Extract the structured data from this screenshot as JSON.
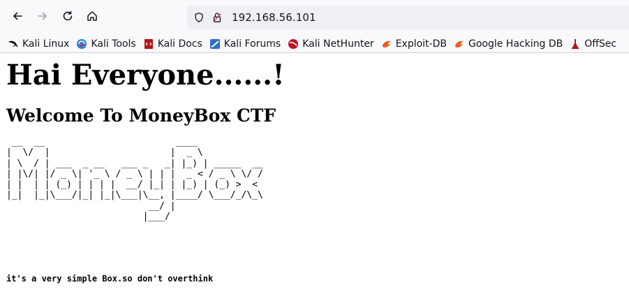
{
  "browser": {
    "url": "192.168.56.101",
    "icons": {
      "back": "arrow-left-icon",
      "forward": "arrow-right-icon",
      "reload": "reload-icon",
      "home": "home-icon",
      "shield": "shield-icon",
      "lock": "lock-icon"
    }
  },
  "bookmarks": [
    {
      "label": "Kali Linux",
      "icon": "kali-dragon-icon",
      "color": "#000000"
    },
    {
      "label": "Kali Tools",
      "icon": "kali-tools-icon",
      "color": "#2f7fd6"
    },
    {
      "label": "Kali Docs",
      "icon": "kali-docs-icon",
      "color": "#b5121b"
    },
    {
      "label": "Kali Forums",
      "icon": "kali-forums-icon",
      "color": "#2a6fc9"
    },
    {
      "label": "Kali NetHunter",
      "icon": "nethunter-icon",
      "color": "#c0111f"
    },
    {
      "label": "Exploit-DB",
      "icon": "exploit-db-icon",
      "color": "#ef5a1e"
    },
    {
      "label": "Google Hacking DB",
      "icon": "ghdb-icon",
      "color": "#ef5a1e"
    },
    {
      "label": "OffSec",
      "icon": "offsec-icon",
      "color": "#b5121b"
    }
  ],
  "page": {
    "heading": "Hai Everyone......!",
    "subheading": "Welcome To MoneyBox CTF",
    "ascii_art": " __  __                        ____            \n|  \\/  |                      |  _ \\           \n| \\  / | ___  _ __   ___ _   _| |_) | _____  __\n| |\\/| |/ _ \\| '_ \\ / _ \\ | | |  _ < / _ \\ \\/ /\n| |  | | (_) | | | |  __/ |_| | |_) | (_) >  < \n|_|  |_|\\___/|_| |_|\\___|\\__, |____/ \\___/_/\\_\\\n                          __/ |                \n                         |___/                 ",
    "hint": "it's a very simple Box.so don't overthink"
  }
}
